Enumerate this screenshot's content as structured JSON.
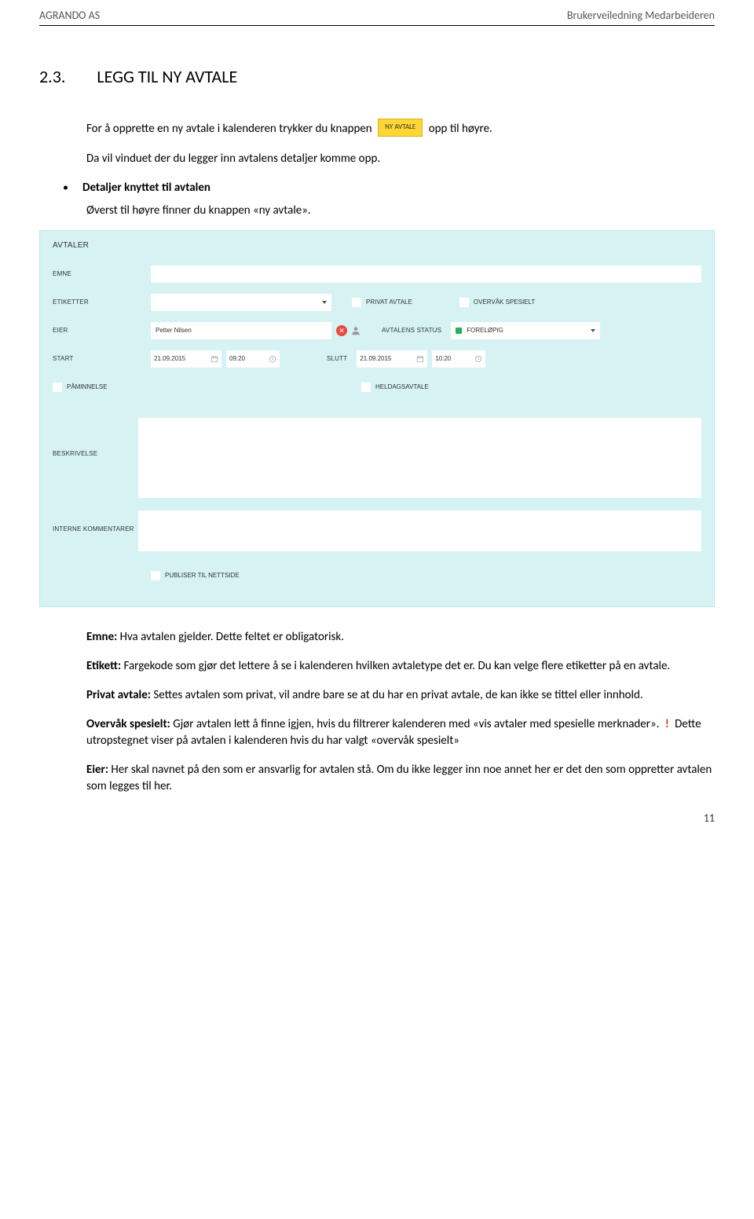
{
  "header": {
    "left": "AGRANDO AS",
    "right": "Brukerveiledning Medarbeideren"
  },
  "section": {
    "number": "2.3.",
    "title": "LEGG TIL NY AVTALE"
  },
  "intro": {
    "line1_a": "For å opprette en ny avtale i kalenderen trykker du knappen",
    "btn": "NY AVTALE",
    "line1_b": "opp til høyre.",
    "line2": "Da vil vinduet der du legger inn avtalens detaljer komme opp."
  },
  "bullet1": {
    "title": "Detaljer knyttet til avtalen",
    "sub": "Øverst til høyre finner du knappen «ny avtale»."
  },
  "app": {
    "title": "AVTALER",
    "labels": {
      "emne": "EMNE",
      "etiketter": "ETIKETTER",
      "privat": "PRIVAT AVTALE",
      "overvak": "OVERVÅK SPESIELT",
      "eier": "EIER",
      "eier_val": "Petter Nilsen",
      "avtalens_status": "AVTALENS STATUS",
      "status_val": "FORELØPIG",
      "start": "START",
      "start_date": "21.09.2015",
      "start_time": "09:20",
      "slutt": "SLUTT",
      "end_date": "21.09.2015",
      "end_time": "10:20",
      "paminnelse": "PÅMINNELSE",
      "heldag": "HELDAGSAVTALE",
      "beskrivelse": "BESKRIVELSE",
      "interne": "INTERNE KOMMENTARER",
      "publiser": "PUBLISER TIL NETTSIDE"
    }
  },
  "desc": {
    "emne_b": "Emne:",
    "emne_t": " Hva avtalen gjelder. Dette feltet er obligatorisk.",
    "etik_b": "Etikett:",
    "etik_t": " Fargekode som gjør det lettere å se i kalenderen hvilken avtaletype det er. Du kan velge flere etiketter på en avtale.",
    "priv_b": "Privat avtale:",
    "priv_t": " Settes avtalen som privat, vil andre bare se at du har en privat avtale, de kan ikke se tittel eller innhold.",
    "over_b": "Overvåk spesielt:",
    "over_t1": " Gjør avtalen lett å finne igjen, hvis du filtrerer kalenderen med «vis avtaler med spesielle merknader».",
    "over_t2": " Dette utropstegnet viser på avtalen i kalenderen hvis du har valgt «overvåk spesielt»",
    "eier_b": "Eier:",
    "eier_t": " Her skal navnet på den som er ansvarlig for avtalen stå. Om du ikke legger inn noe annet her er det den som oppretter avtalen som legges til her."
  },
  "pagenum": "11"
}
